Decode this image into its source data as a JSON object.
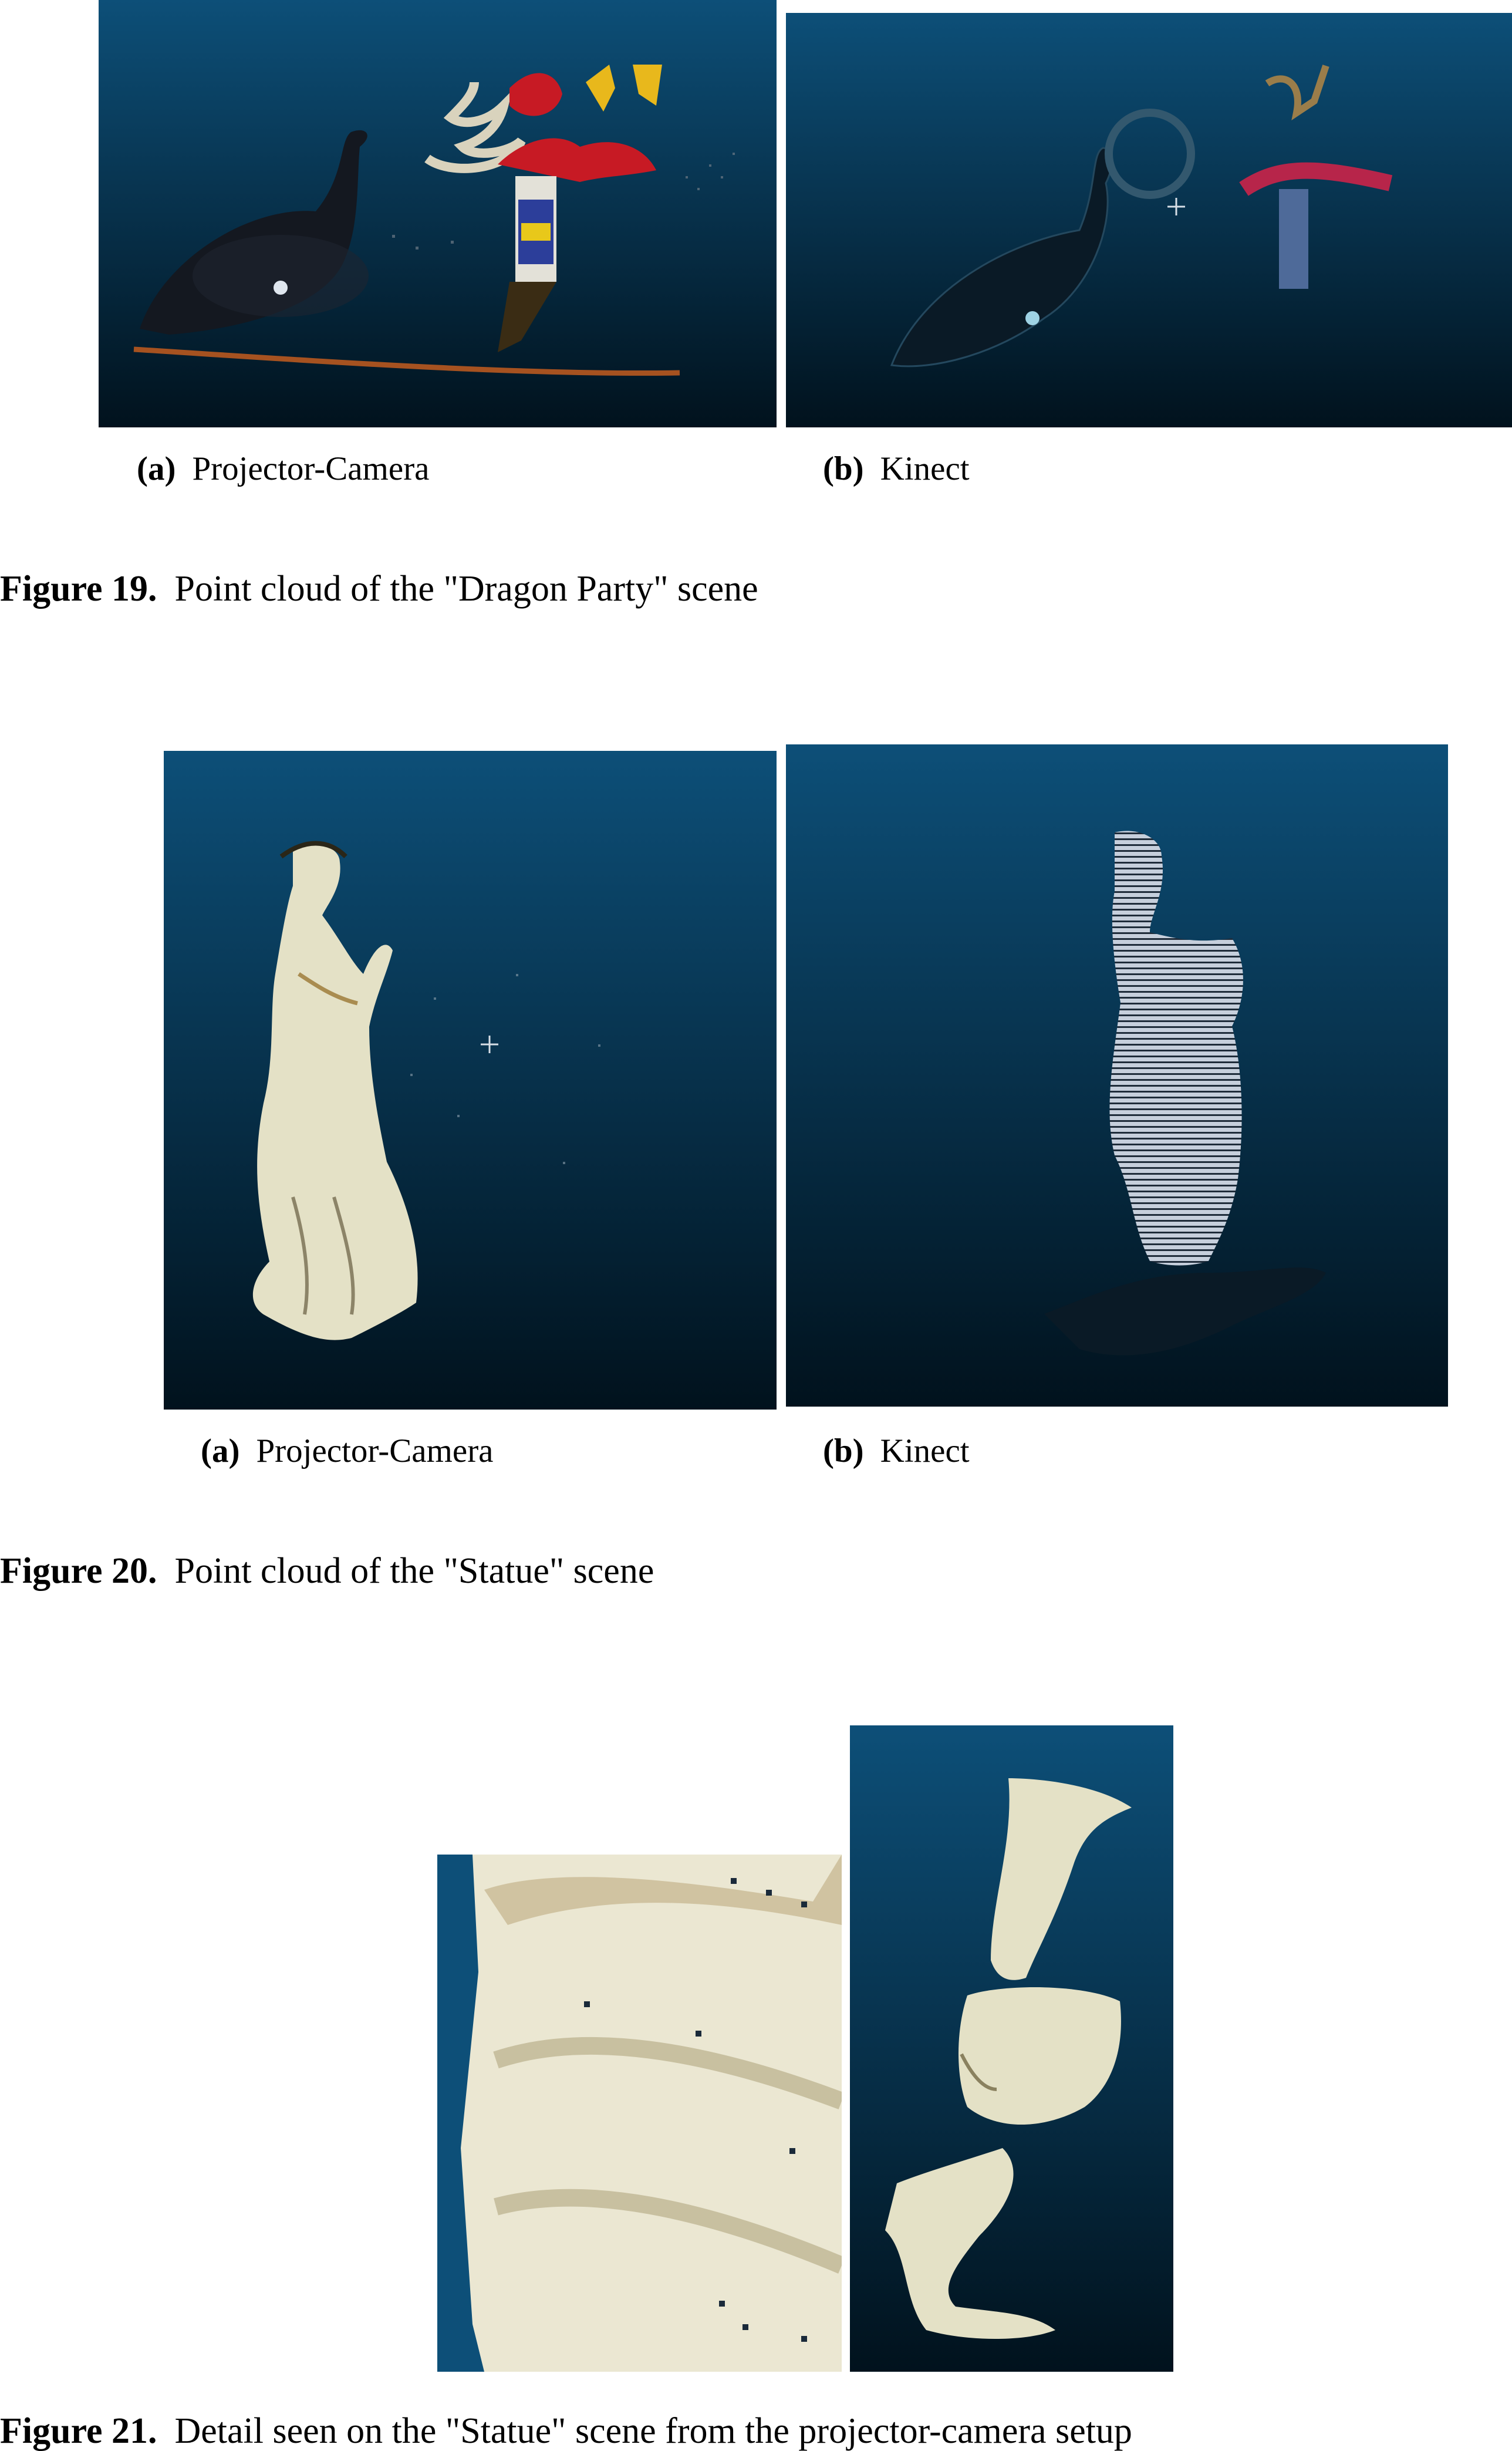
{
  "figures": [
    {
      "number": "Figure 19.",
      "caption": "Point cloud of the \"Dragon Party\" scene",
      "subfigures": [
        {
          "tag": "(a)",
          "label": "Projector-Camera"
        },
        {
          "tag": "(b)",
          "label": "Kinect"
        }
      ]
    },
    {
      "number": "Figure 20.",
      "caption": "Point cloud of the \"Statue\" scene",
      "subfigures": [
        {
          "tag": "(a)",
          "label": "Projector-Camera"
        },
        {
          "tag": "(b)",
          "label": "Kinect"
        }
      ]
    },
    {
      "number": "Figure 21.",
      "caption": "Detail seen on the \"Statue\" scene from the projector-camera setup"
    }
  ],
  "colors": {
    "viewer_top": "#0d4f78",
    "viewer_bottom": "#01121d",
    "statue": "#e4e1c6"
  }
}
